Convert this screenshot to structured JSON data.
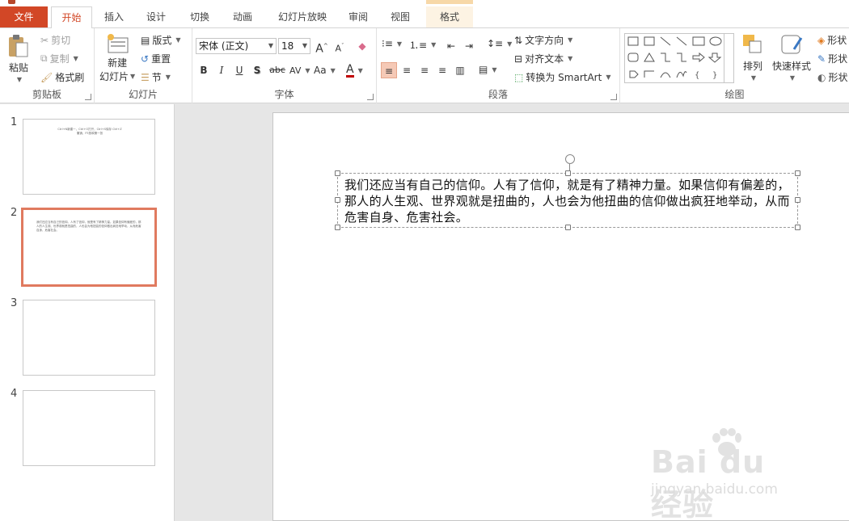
{
  "tabs": [
    {
      "id": "file",
      "label": "文件"
    },
    {
      "id": "home",
      "label": "开始"
    },
    {
      "id": "insert",
      "label": "插入"
    },
    {
      "id": "design",
      "label": "设计"
    },
    {
      "id": "transitions",
      "label": "切换"
    },
    {
      "id": "animations",
      "label": "动画"
    },
    {
      "id": "slideshow",
      "label": "幻灯片放映"
    },
    {
      "id": "review",
      "label": "审阅"
    },
    {
      "id": "view",
      "label": "视图"
    },
    {
      "id": "format",
      "label": "格式"
    }
  ],
  "ribbon": {
    "clipboard": {
      "label": "剪贴板",
      "paste": "粘贴",
      "cut": "剪切",
      "copy": "复制",
      "format_painter": "格式刷"
    },
    "slides": {
      "label": "幻灯片",
      "new_slide_line1": "新建",
      "new_slide_line2": "幻灯片",
      "layout": "版式",
      "reset": "重置",
      "section": "节"
    },
    "font": {
      "label": "字体",
      "font_name": "宋体 (正文)",
      "font_size": "18",
      "grow": "A",
      "shrink": "A",
      "bold": "B",
      "italic": "I",
      "underline": "U",
      "shadow": "S",
      "strikethrough": "abc",
      "spacing": "AV",
      "case": "Aa",
      "font_color": "A",
      "font_color_hex": "#c00000"
    },
    "paragraph": {
      "label": "段落",
      "text_direction": "文字方向",
      "align_text": "对齐文本",
      "convert_smartart": "转换为 SmartArt"
    },
    "drawing": {
      "label": "绘图",
      "arrange": "排列",
      "quick_styles": "快速样式",
      "shape_fill": "形状",
      "shape_outline": "形状",
      "shape_effects": "形状"
    }
  },
  "thumbnails": [
    {
      "number": "1",
      "text": "Ctrl+N新建一，Ctrl+O打开，Ctrl+S保存 Ctrl+Z撤销，F5放映第一张"
    },
    {
      "number": "2",
      "text": "我们还应当有自己的信仰。人有了信仰，就是有了精神力量。如果信仰有偏差的，那人的人生观、世界观就是扭曲的，人也会为他扭曲的信仰做出疯狂地举动，从而危害自身、危害社会。"
    },
    {
      "number": "3",
      "text": ""
    },
    {
      "number": "4",
      "text": ""
    }
  ],
  "slide": {
    "textbox_text": "我们还应当有自己的信仰。人有了信仰，就是有了精神力量。如果信仰有偏差的，那人的人生观、世界观就是扭曲的，人也会为他扭曲的信仰做出疯狂地举动，从而危害自身、危害社会。"
  },
  "watermark": {
    "brand": "Bai du 经验",
    "url": "jingyan.baidu.com"
  },
  "colors": {
    "accent": "#d24726",
    "selected_thumb": "#e07a5f",
    "context_tab": "#fdf3e3"
  }
}
